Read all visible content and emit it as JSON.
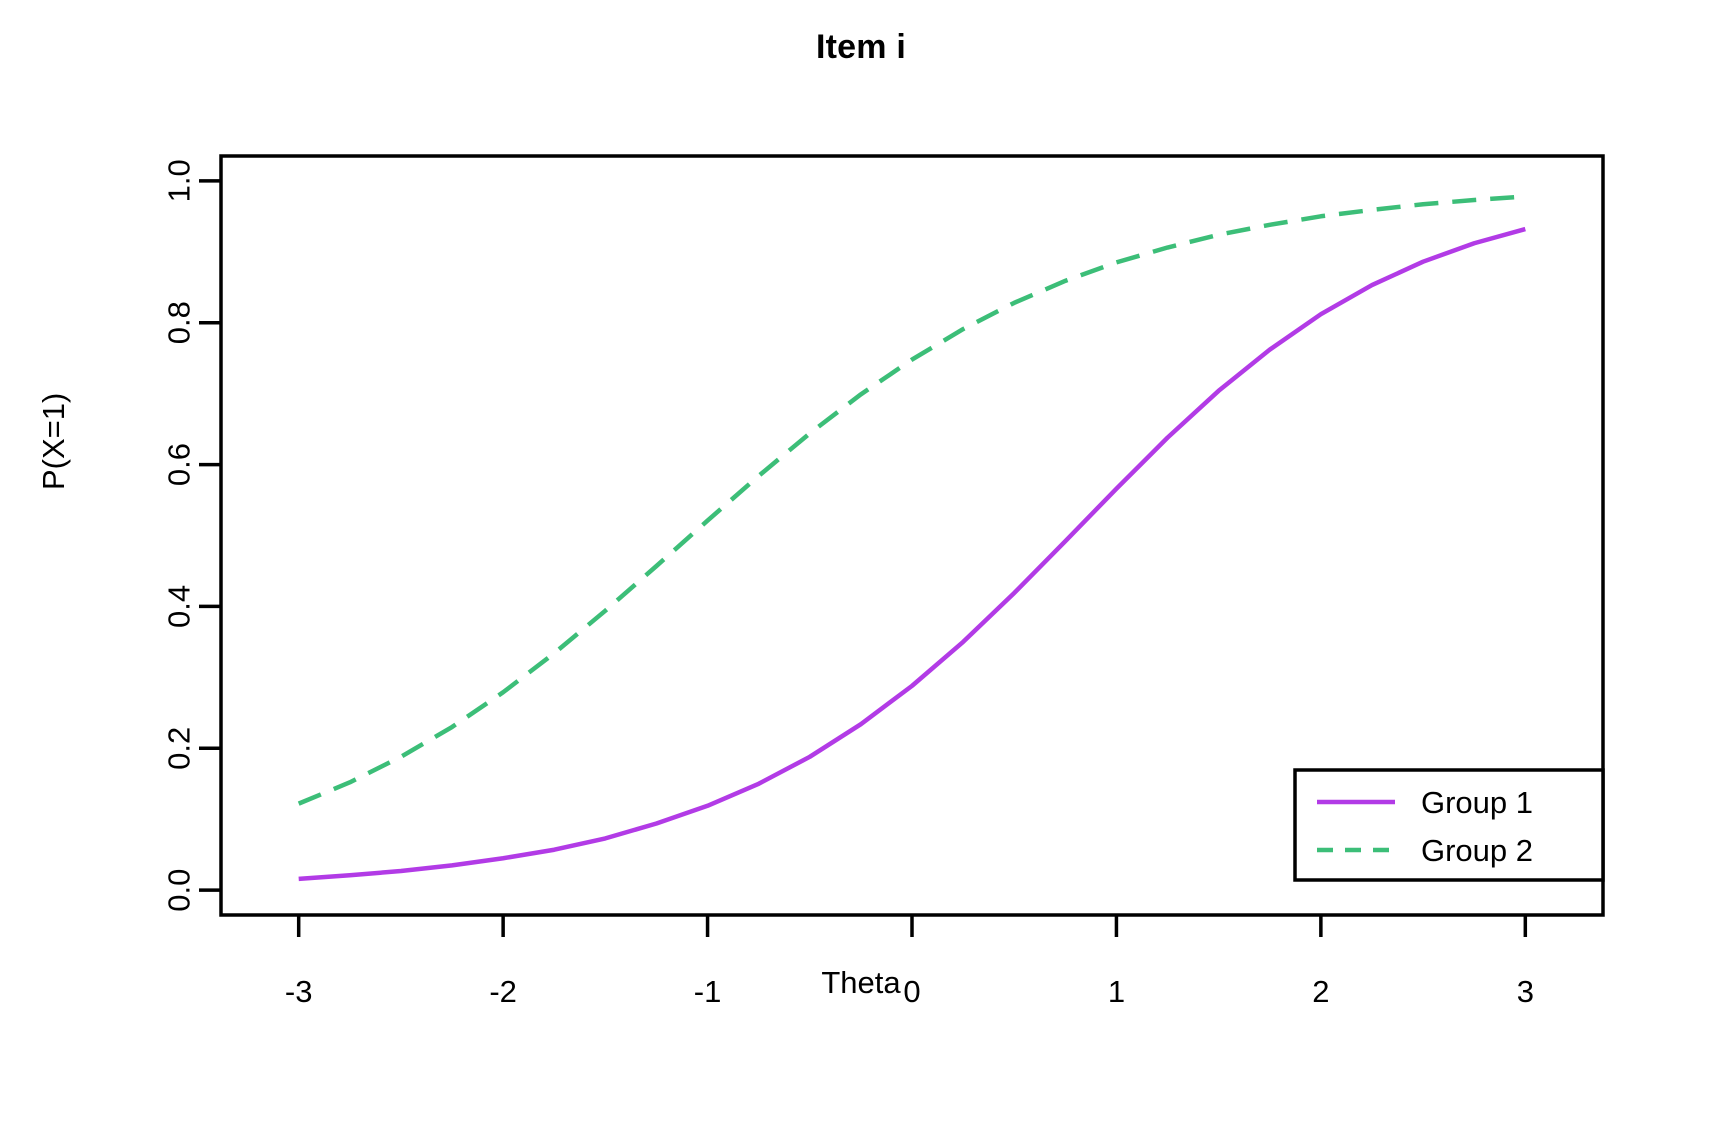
{
  "chart_data": {
    "type": "line",
    "title": "Item i",
    "xlabel": "Theta",
    "ylabel": "P(X=1)",
    "xlim": [
      -3.38,
      3.38
    ],
    "ylim": [
      -0.035,
      1.035
    ],
    "xticks": [
      -3,
      -2,
      -1,
      0,
      1,
      2,
      3
    ],
    "xtick_labels": [
      "-3",
      "-2",
      "-1",
      "0",
      "1",
      "2",
      "3"
    ],
    "yticks": [
      0.0,
      0.2,
      0.4,
      0.6,
      0.8,
      1.0
    ],
    "ytick_labels": [
      "0.0",
      "0.2",
      "0.4",
      "0.6",
      "0.8",
      "1.0"
    ],
    "grid": false,
    "legend_position": "bottom-right",
    "x": [
      -3.0,
      -2.75,
      -2.5,
      -2.25,
      -2.0,
      -1.75,
      -1.5,
      -1.25,
      -1.0,
      -0.75,
      -0.5,
      -0.25,
      0.0,
      0.25,
      0.5,
      0.75,
      1.0,
      1.25,
      1.5,
      1.75,
      2.0,
      2.25,
      2.5,
      2.75,
      3.0
    ],
    "series": [
      {
        "name": "Group 1",
        "color": "#B23BE6",
        "linestyle": "solid",
        "values": [
          0.016,
          0.021,
          0.027,
          0.035,
          0.045,
          0.057,
          0.073,
          0.094,
          0.119,
          0.15,
          0.188,
          0.234,
          0.288,
          0.35,
          0.419,
          0.492,
          0.566,
          0.638,
          0.704,
          0.762,
          0.812,
          0.853,
          0.886,
          0.912,
          0.932
        ]
      },
      {
        "name": "Group 2",
        "color": "#3CBE78",
        "linestyle": "dashed",
        "values": [
          0.122,
          0.152,
          0.188,
          0.23,
          0.279,
          0.334,
          0.394,
          0.457,
          0.521,
          0.584,
          0.644,
          0.699,
          0.748,
          0.791,
          0.828,
          0.859,
          0.885,
          0.906,
          0.924,
          0.938,
          0.95,
          0.959,
          0.967,
          0.973,
          0.978
        ]
      }
    ]
  },
  "legend": {
    "entries": [
      {
        "label": "Group 1",
        "color": "#B23BE6",
        "linestyle": "solid"
      },
      {
        "label": "Group 2",
        "color": "#3CBE78",
        "linestyle": "dashed"
      }
    ]
  },
  "axes": {
    "x_tick_labels": [
      "-3",
      "-2",
      "-1",
      "0",
      "1",
      "2",
      "3"
    ],
    "y_tick_labels": [
      "0.0",
      "0.2",
      "0.4",
      "0.6",
      "0.8",
      "1.0"
    ]
  }
}
